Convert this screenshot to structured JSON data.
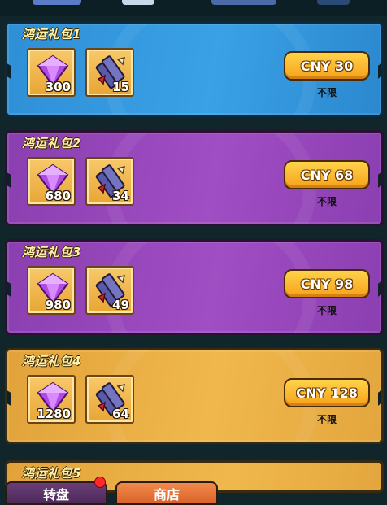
{
  "packs": [
    {
      "title": "鸿运礼包1",
      "gems": "300",
      "scrolls": "15",
      "price": "CNY 30",
      "limit": "不限",
      "theme": "blue"
    },
    {
      "title": "鸿运礼包2",
      "gems": "680",
      "scrolls": "34",
      "price": "CNY 68",
      "limit": "不限",
      "theme": "purple"
    },
    {
      "title": "鸿运礼包3",
      "gems": "980",
      "scrolls": "49",
      "price": "CNY 98",
      "limit": "不限",
      "theme": "purple"
    },
    {
      "title": "鸿运礼包4",
      "gems": "1280",
      "scrolls": "64",
      "price": "CNY 128",
      "limit": "不限",
      "theme": "gold"
    },
    {
      "title": "鸿运礼包5"
    }
  ],
  "tabs": {
    "wheel": "转盘",
    "shop": "商店"
  },
  "icons": {
    "gem": "purple-gem-icon",
    "item": "scroll-bundle-icon",
    "badge": "red-notification-dot"
  },
  "colors": {
    "blue": "#3aa1e6",
    "purple": "#a04ec3",
    "gold": "#f0b84c",
    "button": "#f7a11a"
  }
}
